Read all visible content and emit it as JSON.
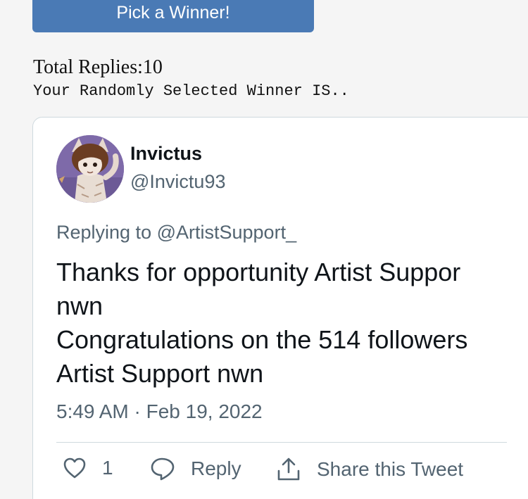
{
  "pick_button": {
    "label": "Pick a Winner!"
  },
  "summary": {
    "total_replies_label": "Total Replies:",
    "total_replies_count": "10",
    "winner_announcement": "Your Randomly Selected Winner IS.."
  },
  "tweet": {
    "author": {
      "display_name": "Invictus",
      "handle": "@Invictu93"
    },
    "replying_to_prefix": "Replying to ",
    "replying_to_handle": "@ArtistSupport_",
    "text_lines": [
      "Thanks for opportunity Artist Suppor",
      "nwn",
      "Congratulations on the 514 followers",
      "Artist Support nwn"
    ],
    "timestamp": "5:49 AM · Feb 19, 2022",
    "actions": {
      "like_icon": "heart-icon",
      "like_count": "1",
      "reply_icon": "speech-bubble-icon",
      "reply_label": "Reply",
      "share_icon": "share-arrow-icon",
      "share_label": "Share this Tweet"
    }
  },
  "colors": {
    "button_bg": "#4a7ab5",
    "page_bg": "#f5f5f5",
    "card_border": "#cfd9de",
    "secondary_text": "#536471",
    "primary_text": "#0f1419"
  }
}
